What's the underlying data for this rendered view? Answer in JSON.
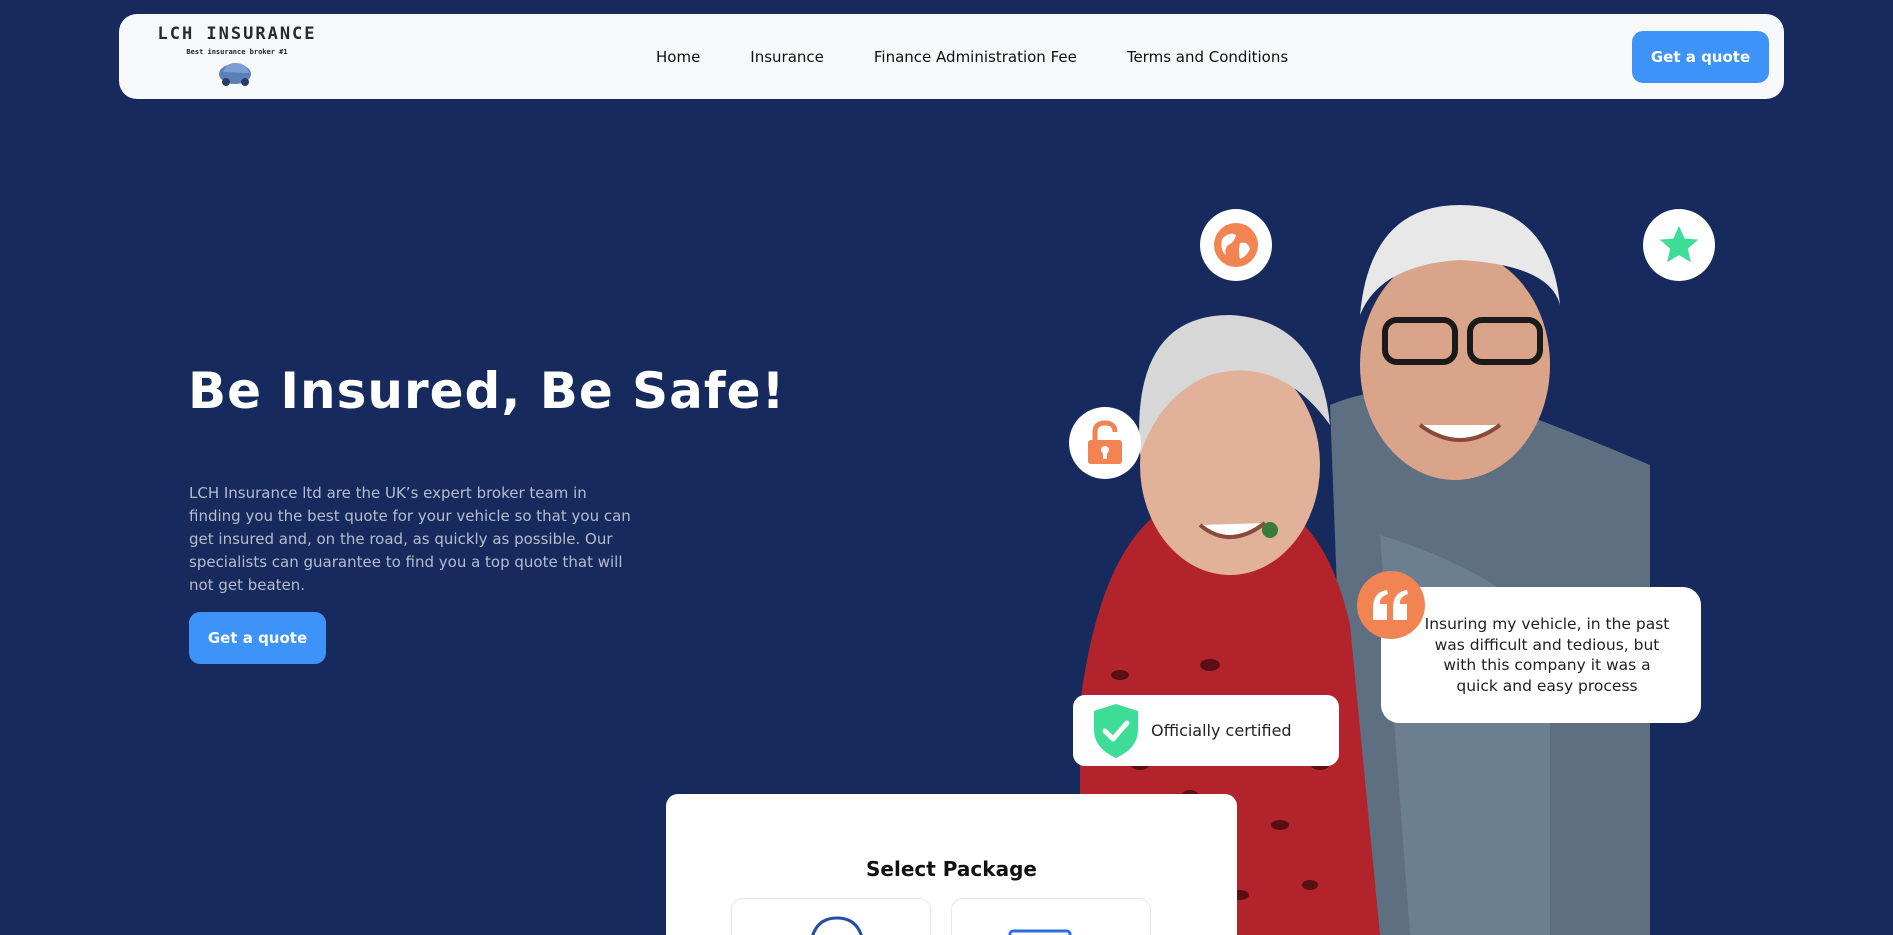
{
  "brand": {
    "name": "LCH INSURANCE",
    "tagline": "Best insurance broker #1",
    "logo_icon": "car-icon"
  },
  "nav": {
    "links": [
      "Home",
      "Insurance",
      "Finance Administration Fee",
      "Terms and Conditions"
    ],
    "cta_label": "Get a quote"
  },
  "hero": {
    "title": "Be Insured, Be Safe!",
    "description": "LCH Insurance ltd are the UK’s expert broker team in finding you the best quote for your vehicle so that you can get insured and, on the road, as quickly as possible. Our specialists can guarantee to find you a top quote that will not get beaten.",
    "cta_label": "Get a quote"
  },
  "badges": {
    "icons": [
      "globe-icon",
      "star-icon",
      "lock-icon"
    ],
    "certified_label": "Officially certified",
    "certified_icon": "shield-check-icon"
  },
  "testimonial": {
    "text": "Insuring my vehicle, in the past was difficult and tedious, but with this company it was a quick and easy process",
    "icon": "quote-icon"
  },
  "package": {
    "title": "Select Package"
  },
  "colors": {
    "background": "#172a5d",
    "accent": "#3d93f7",
    "orange": "#f28453",
    "green": "#3ddc97"
  }
}
